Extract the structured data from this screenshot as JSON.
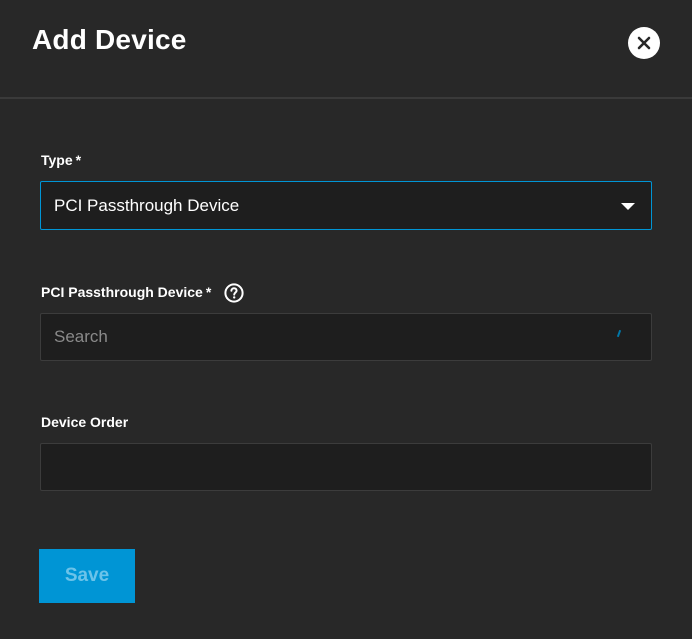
{
  "dialog": {
    "title": "Add Device",
    "close_icon": "close-icon"
  },
  "form": {
    "type": {
      "label": "Type",
      "required_mark": "*",
      "value": "PCI Passthrough Device"
    },
    "pci_device": {
      "label": "PCI Passthrough Device",
      "required_mark": "*",
      "placeholder": "Search",
      "help_icon": "help-circle-icon"
    },
    "device_order": {
      "label": "Device Order",
      "value": ""
    }
  },
  "actions": {
    "save_label": "Save",
    "save_enabled": false
  },
  "colors": {
    "background": "#282828",
    "field_background": "#1e1e1e",
    "accent": "#0095d5",
    "save_text_disabled": "#6cc3e9"
  }
}
